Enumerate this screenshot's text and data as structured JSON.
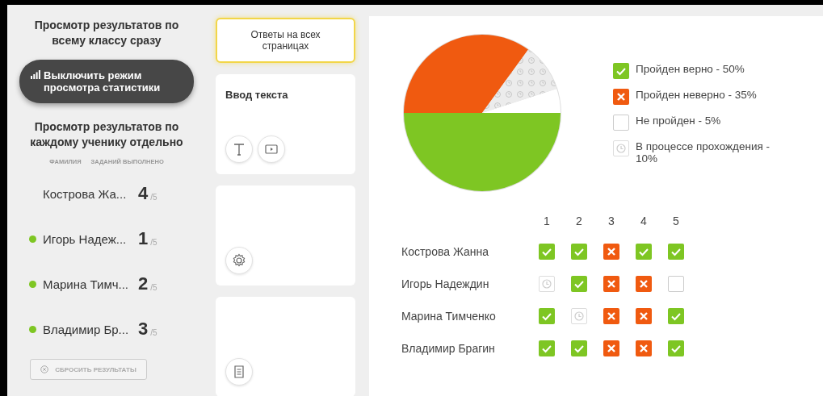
{
  "class_view": {
    "heading": "Просмотр результатов по всему классу сразу",
    "toggle_button": "Выключить режим просмотра статистики"
  },
  "student_view": {
    "heading": "Просмотр результатов по каждому ученику отдельно",
    "columns": [
      "ФАМИЛИЯ",
      "ЗАДАНИЙ ВЫПОЛНЕНО"
    ],
    "students": [
      {
        "name": "Кострова Жа...",
        "done": "4",
        "total": "/5",
        "online": false
      },
      {
        "name": "Игорь Надеж...",
        "done": "1",
        "total": "/5",
        "online": true
      },
      {
        "name": "Марина Тимч...",
        "done": "2",
        "total": "/5",
        "online": true
      },
      {
        "name": "Владимир Бр...",
        "done": "3",
        "total": "/5",
        "online": true
      }
    ],
    "reset_button": "СБРОСИТЬ РЕЗУЛЬТАТЫ"
  },
  "pages": [
    {
      "label": "Ответы на всех страницах",
      "selected": true
    },
    {
      "label": "Ввод текста",
      "selected": false,
      "icons": [
        {
          "kind": "text"
        },
        {
          "kind": "video"
        }
      ]
    },
    {
      "selected": false,
      "icons": [
        {
          "kind": "settings"
        }
      ]
    },
    {
      "selected": false,
      "icons": [
        {
          "kind": "document"
        }
      ]
    }
  ],
  "summary": {
    "chart_data": {
      "type": "pie",
      "values": [
        50,
        35,
        5,
        10
      ]
    },
    "legend": [
      {
        "kind": "correct",
        "label": "Пройден верно - 50%"
      },
      {
        "kind": "incorrect",
        "label": "Пройден неверно - 35%"
      },
      {
        "kind": "none",
        "label": "Не пройден - 5%"
      },
      {
        "kind": "progress",
        "label": "В процессе прохождения - 10%"
      }
    ]
  },
  "results": {
    "columns": [
      "1",
      "2",
      "3",
      "4",
      "5"
    ],
    "rows": [
      {
        "name": "Кострова Жанна",
        "cells": [
          {
            "kind": "correct"
          },
          {
            "kind": "correct"
          },
          {
            "kind": "incorrect"
          },
          {
            "kind": "correct"
          },
          {
            "kind": "correct"
          }
        ]
      },
      {
        "name": "Игорь Надеждин",
        "cells": [
          {
            "kind": "progress"
          },
          {
            "kind": "correct"
          },
          {
            "kind": "incorrect"
          },
          {
            "kind": "incorrect"
          },
          {
            "kind": "none"
          }
        ]
      },
      {
        "name": "Марина Тимченко",
        "cells": [
          {
            "kind": "correct"
          },
          {
            "kind": "progress"
          },
          {
            "kind": "incorrect"
          },
          {
            "kind": "incorrect"
          },
          {
            "kind": "correct"
          }
        ]
      },
      {
        "name": "Владимир Брагин",
        "cells": [
          {
            "kind": "correct"
          },
          {
            "kind": "correct"
          },
          {
            "kind": "incorrect"
          },
          {
            "kind": "incorrect"
          },
          {
            "kind": "correct"
          }
        ]
      }
    ]
  }
}
